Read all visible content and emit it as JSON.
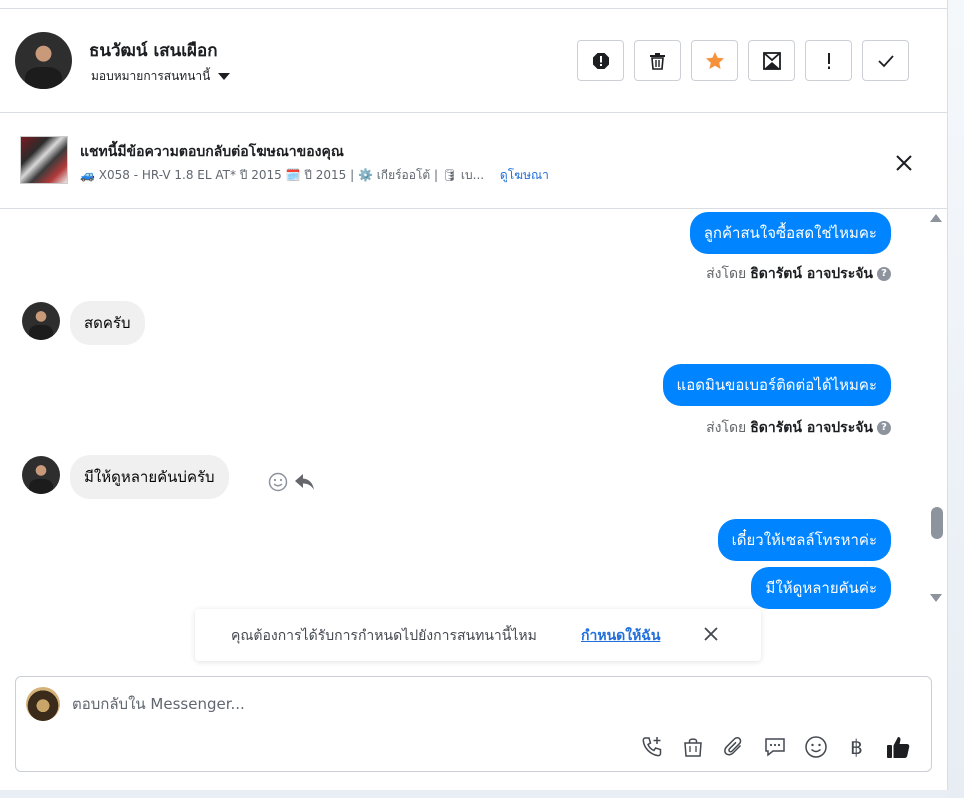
{
  "header": {
    "contact_name": "ธนวัฒน์ เสนเผือก",
    "assign_label": "มอบหมายการสนทนานี้",
    "actions": [
      {
        "name": "spam-button",
        "icon": "alert-octagon-icon"
      },
      {
        "name": "delete-button",
        "icon": "trash-icon"
      },
      {
        "name": "star-button",
        "icon": "star-icon"
      },
      {
        "name": "mark-unread-button",
        "icon": "envelope-icon"
      },
      {
        "name": "follow-up-button",
        "icon": "exclamation-icon"
      },
      {
        "name": "mark-done-button",
        "icon": "check-icon"
      }
    ]
  },
  "ad_context": {
    "title": "แชทนี้มีข้อความตอบกลับต่อโฆษณาของคุณ",
    "subtitle": "🚙 X058 - HR-V 1.8 EL AT* ปี 2015 🗓️ ปี 2015 | ⚙️ เกียร์ออโต้ | 🛢 เบ...",
    "view_ad": "ดูโฆษณา"
  },
  "messages": [
    {
      "type": "out",
      "text": "ลูกค้าสนใจซื้อสดใช่ไหมคะ"
    },
    {
      "type": "sent_by",
      "prefix": "ส่งโดย",
      "name": "ธิดารัตน์ อาจประจัน"
    },
    {
      "type": "in",
      "text": "สดครับ"
    },
    {
      "type": "out",
      "text": "แอดมินขอเบอร์ติดต่อได้ไหมคะ"
    },
    {
      "type": "sent_by",
      "prefix": "ส่งโดย",
      "name": "ธิดารัตน์ อาจประจัน"
    },
    {
      "type": "in",
      "text": "มีให้ดูหลายคันบ่ครับ"
    },
    {
      "type": "out",
      "text": "เดี๋ยวให้เซลล์โทรหาค่ะ"
    },
    {
      "type": "out",
      "text": "มีให้ดูหลายคันค่ะ"
    }
  ],
  "assign_prompt": {
    "text": "คุณต้องการได้รับการกำหนดไปยังการสนทนานี้ไหม",
    "link": "กำหนดให้ฉัน"
  },
  "composer": {
    "placeholder": "ตอบกลับใน Messenger...",
    "baht_symbol": "฿",
    "tools": [
      "call-add-icon",
      "shopping-bag-icon",
      "paperclip-icon",
      "saved-reply-icon",
      "emoji-icon",
      "baht-icon",
      "thumbs-up-icon"
    ]
  },
  "colors": {
    "accent": "#0084ff",
    "link": "#216fdb",
    "star": "#f7923b"
  }
}
